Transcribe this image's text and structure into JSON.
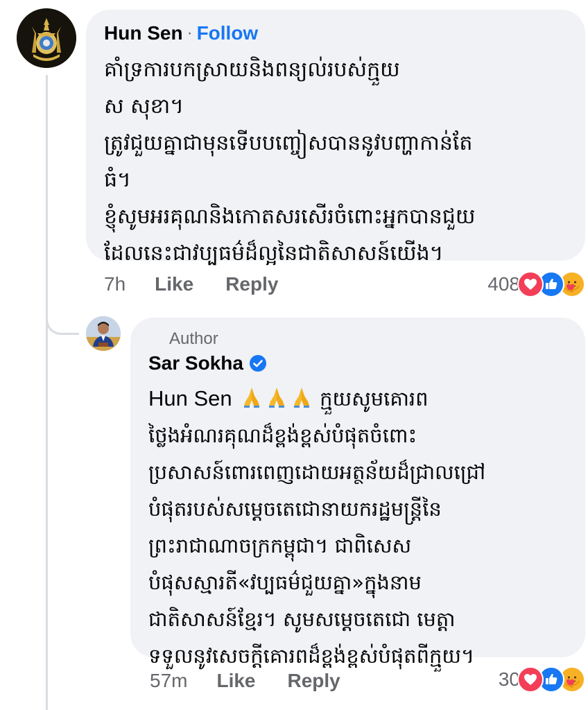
{
  "colors": {
    "bubble_bg": "#f0f2f5",
    "follow_blue": "#1877f2",
    "secondary_text": "#65676b",
    "love_red": "#f33e58",
    "like_blue": "#1877f2",
    "care_yellow": "#f7b125"
  },
  "comment": {
    "author": "Hun Sen",
    "separator": "·",
    "follow_label": "Follow",
    "lines": [
      "គាំទ្រការបកស្រាយនិងពន្យល់របស់ក្មួយ",
      "ស សុខា។",
      "ត្រូវជួយគ្នាជាមុនទើបបញ្ចៀសបាននូវបញ្ហាកាន់តែ",
      "ធំ។",
      "ខ្ញុំសូមអរគុណនិងកោតសរសើរចំពោះអ្នកបានជួយ",
      "ដែលនេះជាវប្បធម៌ដ៏ល្អនៃជាតិសាសន៍យើង។"
    ],
    "time": "7h",
    "like_label": "Like",
    "reply_label": "Reply",
    "reaction_count": "408",
    "reactions": [
      "love-icon",
      "like-icon",
      "care-icon"
    ]
  },
  "reply": {
    "badge": "Author",
    "author": "Sar Sokha",
    "verified": "verified-badge-icon",
    "mention": "Hun Sen",
    "mention_emoji": [
      "folded-hands-icon",
      "folded-hands-icon",
      "folded-hands-icon"
    ],
    "first_line_rest": "ក្មួយសូមគោរព",
    "lines": [
      "ថ្លៃងអំណរគុណដ៏ខ្ពង់ខ្ពស់បំផុតចំពោះ",
      "ប្រសាសន៍ពោរពេញដោយអត្ថន័យដ៏ជ្រាលជ្រៅ",
      "បំផុតរបស់សម្តេចតេជោនាយករដ្ឋមន្ត្រីនៃ",
      "ព្រះរាជាណាចក្រកម្ពុជា។ ជាពិសេស",
      "បំផុសស្មារតី«វប្បធម៌ជួយគ្នា»ក្នុងនាម",
      "ជាតិសាសន៍ខ្មែរ។ សូមសម្តេចតេជោ មេត្តា",
      "ទទួលនូវសេចក្តីគោរពដ៏ខ្ពង់ខ្ពស់បំផុតពីក្មួយ។"
    ],
    "time": "57m",
    "like_label": "Like",
    "reply_label": "Reply",
    "reaction_count": "30",
    "reactions": [
      "love-icon",
      "like-icon",
      "care-icon"
    ]
  }
}
